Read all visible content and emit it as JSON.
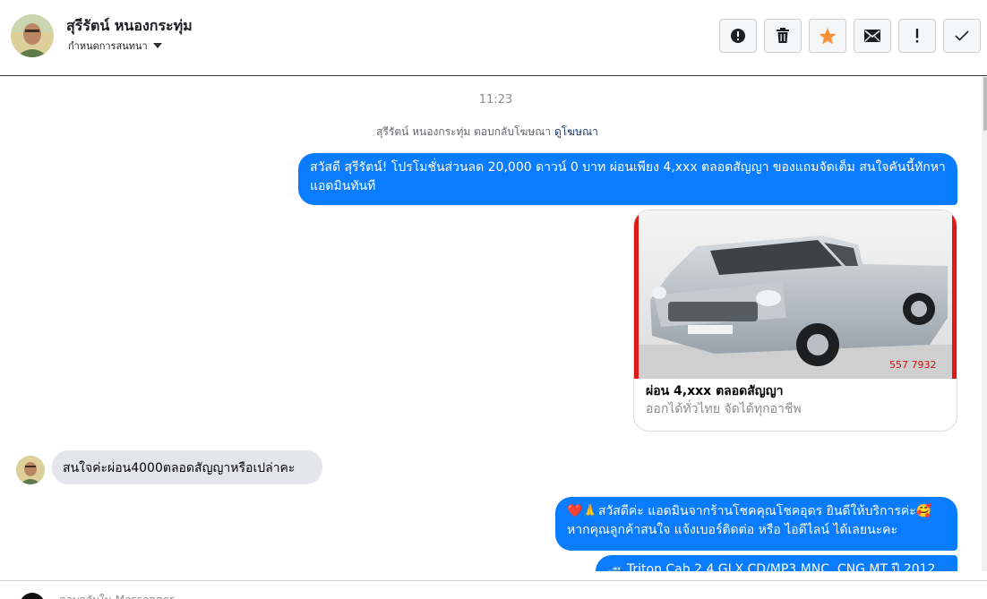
{
  "header": {
    "contact_name": "สุรีรัตน์ หนองกระทุ่ม",
    "assign_label": "กำหนดการสนทนา",
    "actions": [
      {
        "name": "spam-button",
        "icon": "alert-circle-icon"
      },
      {
        "name": "delete-button",
        "icon": "trash-icon"
      },
      {
        "name": "star-button",
        "icon": "star-icon"
      },
      {
        "name": "mark-unread-button",
        "icon": "envelope-icon"
      },
      {
        "name": "important-button",
        "icon": "exclamation-icon"
      },
      {
        "name": "done-button",
        "icon": "checkmark-icon"
      }
    ]
  },
  "thread": {
    "timestamp": "11:23",
    "system_text": "สุรีรัตน์ หนองกระทุ่ม ตอบกลับโฆษณา",
    "system_link": "ดูโฆษณา",
    "messages": {
      "out1": "สวัสดี สุรีรัตน์! โปรโมชั่นส่วนลด 20,000 ดาวน์ 0 บาท ผ่อนเพียง 4,xxx ตลอดสัญญา ของแถมจัดเต็ม สนใจคันนี้ทักหาแอดมินทันที",
      "card_title": "ผ่อน 4,xxx ตลอดสัญญา",
      "card_subtitle": "ออกได้ทั่วไทย จัดได้ทุกอาชีพ",
      "card_image_text": "557 7932",
      "in1": "สนใจค่ะผ่อน4000ตลอดสัญญาหรือเปล่าคะ",
      "out2_line1": "❤️🙏สวัสดีค่ะ แอดมินจากร้านโชคคุณโชคอุดร ยินดีให้บริการค่ะ🥰",
      "out2_line2": "หากคุณลูกค้าสนใจ แจ้งเบอร์ติดต่อ หรือ ไอดีไลน์ ได้เลยนะคะ",
      "out3": "🚙 Triton Cab 2.4 GLX CD/MP3 MNC, CNG MT ปี 2012"
    }
  },
  "composer": {
    "placeholder": "ตอบกลับใน Messenger..."
  },
  "colors": {
    "accent": "#0a7cff",
    "star": "#f7923a",
    "incoming_bubble": "#e4e6eb"
  }
}
